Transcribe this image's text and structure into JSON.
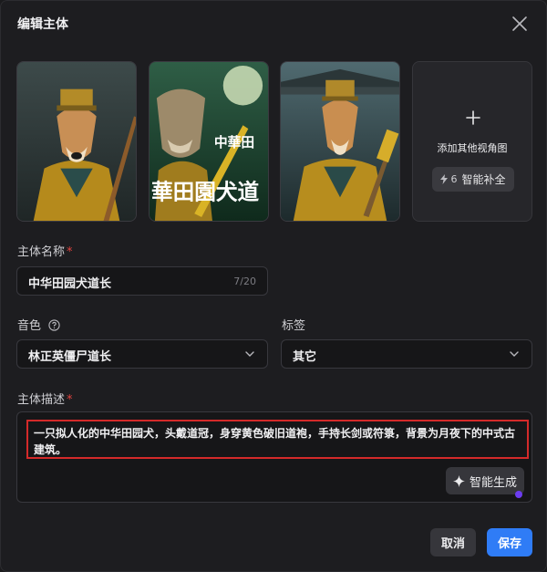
{
  "dialog": {
    "title": "编辑主体"
  },
  "gallery": {
    "images": [
      {
        "alt": "dog-taoist-portrait-1"
      },
      {
        "alt": "dog-taoist-poster-with-title"
      },
      {
        "alt": "dog-taoist-portrait-3"
      }
    ],
    "poster_text_vertical": "中華田",
    "poster_text_horizontal": "華田園犬道",
    "add_view": {
      "label": "添加其他视角图",
      "smart_fill_count": "6",
      "smart_fill_label": "智能补全"
    }
  },
  "name_field": {
    "label": "主体名称",
    "required_mark": "*",
    "value": "中华田园犬道长",
    "counter": "7/20"
  },
  "voice_field": {
    "label": "音色",
    "value": "林正英僵尸道长"
  },
  "tag_field": {
    "label": "标签",
    "value": "其它"
  },
  "description_field": {
    "label": "主体描述",
    "required_mark": "*",
    "value": "一只拟人化的中华田园犬，头戴道冠，身穿黄色破旧道袍，手持长剑或符箓，背景为月夜下的中式古建筑。",
    "generate_label": "智能生成"
  },
  "footer": {
    "cancel_label": "取消",
    "save_label": "保存"
  },
  "colors": {
    "accent": "#2f7cf6",
    "required": "#e0433f",
    "highlight_border": "#d42a2a"
  }
}
